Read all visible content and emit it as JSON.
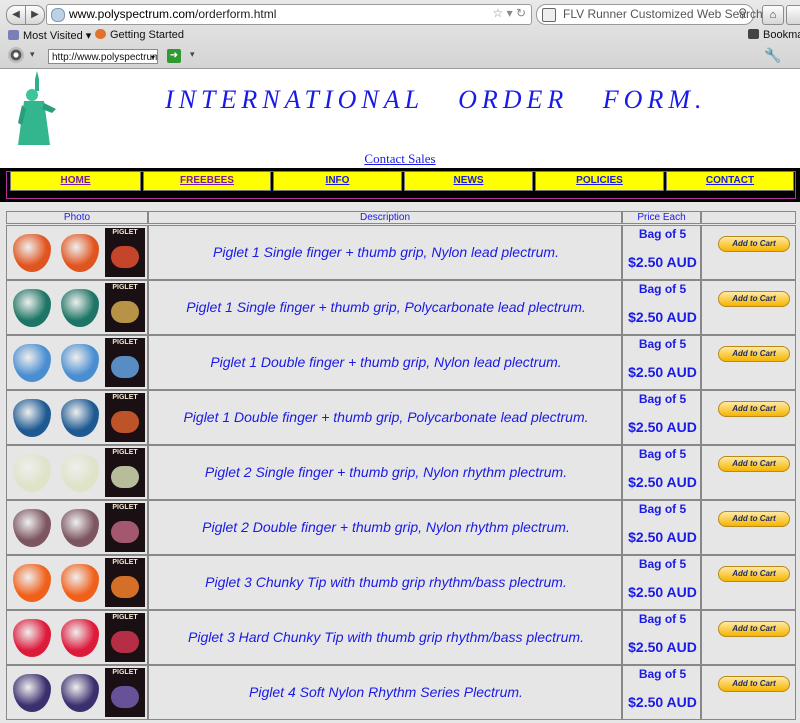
{
  "browser": {
    "url_host": "www.polyspectrum.com",
    "url_path": "/orderform.html",
    "search_placeholder": "FLV Runner Customized Web Search",
    "bookmarks": [
      {
        "label": "Most Visited"
      },
      {
        "label": "Getting Started"
      },
      {
        "label": "Bookmarks"
      }
    ],
    "toolbar_select_value": "http://www.polyspectrum"
  },
  "page": {
    "title": "INTERNATIONAL   ORDER   FORM.",
    "contact_link": "Contact Sales",
    "menu": [
      "HOME",
      "FREEBEES",
      "INFO",
      "NEWS",
      "POLICIES",
      "CONTACT"
    ],
    "colors": {
      "menu_bg": "#ffff00",
      "menu_link": "#1a1ae6",
      "menu_link_visited": "#7a1aa8",
      "text_blue": "#1a1ae6"
    }
  },
  "table": {
    "headers": [
      "Photo",
      "Description",
      "Price Each",
      ""
    ],
    "cart_label": "Add to Cart",
    "rows": [
      {
        "desc": "Piglet 1 Single finger + thumb grip, Nylon lead plectrum.",
        "bag": "Bag of 5",
        "price": "$2.50 AUD",
        "pick_color": "#e0541f",
        "pack_color": "#d84b2c"
      },
      {
        "desc": "Piglet 1 Single finger + thumb grip, Polycarbonate lead plectrum.",
        "bag": "Bag of 5",
        "price": "$2.50 AUD",
        "pick_color": "#1d7565",
        "pack_color": "#c9a24a"
      },
      {
        "desc": "Piglet 1 Double finger + thumb grip, Nylon lead plectrum.",
        "bag": "Bag of 5",
        "price": "$2.50 AUD",
        "pick_color": "#4a8ed0",
        "pack_color": "#5e9bd6"
      },
      {
        "desc": "Piglet 1 Double finger + thumb grip, Polycarbonate lead plectrum.",
        "bag": "Bag of 5",
        "price": "$2.50 AUD",
        "pick_color": "#1e5a92",
        "pack_color": "#d05a2a"
      },
      {
        "desc": "Piglet 2 Single finger + thumb grip, Nylon rhythm plectrum.",
        "bag": "Bag of 5",
        "price": "$2.50 AUD",
        "pick_color": "#dfe3c8",
        "pack_color": "#c9d0a8"
      },
      {
        "desc": "Piglet 2 Double finger + thumb grip, Nylon rhythm plectrum.",
        "bag": "Bag of 5",
        "price": "$2.50 AUD",
        "pick_color": "#7c5560",
        "pack_color": "#b4617a"
      },
      {
        "desc": "Piglet 3 Chunky Tip with thumb grip rhythm/bass plectrum.",
        "bag": "Bag of 5",
        "price": "$2.50 AUD",
        "pick_color": "#f0601a",
        "pack_color": "#e97a2a"
      },
      {
        "desc": "Piglet 3 Hard Chunky Tip with thumb grip rhythm/bass plectrum.",
        "bag": "Bag of 5",
        "price": "$2.50 AUD",
        "pick_color": "#dd1a3a",
        "pack_color": "#c6324a"
      },
      {
        "desc": "Piglet 4 Soft Nylon Rhythm Series Plectrum.",
        "bag": "Bag of 5",
        "price": "$2.50 AUD",
        "pick_color": "#3c2f6e",
        "pack_color": "#6f5aa6"
      }
    ],
    "pack_label": "PIGLET"
  }
}
